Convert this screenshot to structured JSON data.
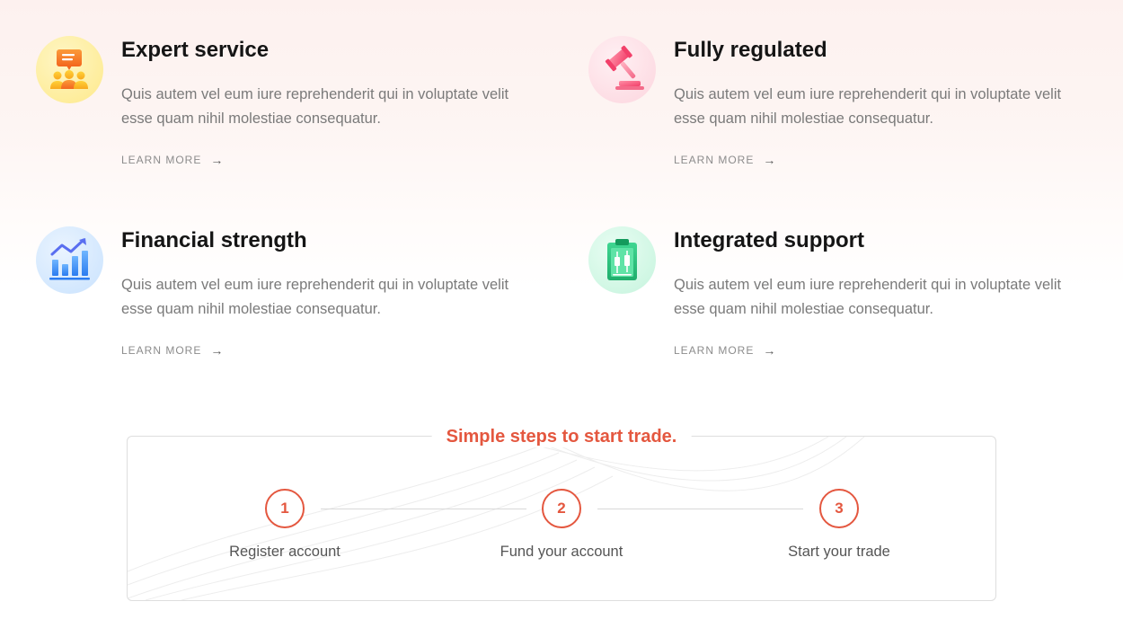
{
  "features": [
    {
      "icon": "team-chat-icon",
      "title": "Expert service",
      "description": "Quis autem vel eum iure reprehenderit qui in voluptate velit esse quam nihil molestiae consequatur.",
      "link_label": "LEARN MORE",
      "link_arrow": "→"
    },
    {
      "icon": "gavel-icon",
      "title": "Fully regulated",
      "description": "Quis autem vel eum iure reprehenderit qui in voluptate velit esse quam nihil molestiae consequatur.",
      "link_label": "LEARN MORE",
      "link_arrow": "→"
    },
    {
      "icon": "growth-chart-icon",
      "title": "Financial strength",
      "description": "Quis autem vel eum iure reprehenderit qui in voluptate velit esse quam nihil molestiae consequatur.",
      "link_label": "LEARN MORE",
      "link_arrow": "→"
    },
    {
      "icon": "clipboard-candlestick-icon",
      "title": "Integrated support",
      "description": "Quis autem vel eum iure reprehenderit qui in voluptate velit esse quam nihil molestiae consequatur.",
      "link_label": "LEARN MORE",
      "link_arrow": "→"
    }
  ],
  "steps_section": {
    "title": "Simple steps to start trade.",
    "steps": [
      {
        "number": "1",
        "label": "Register account"
      },
      {
        "number": "2",
        "label": "Fund your account"
      },
      {
        "number": "3",
        "label": "Start your trade"
      }
    ]
  },
  "colors": {
    "accent": "#e4573f",
    "heading": "#151515",
    "body_text": "#7a7a7a",
    "link_text": "#8c8c8c"
  }
}
